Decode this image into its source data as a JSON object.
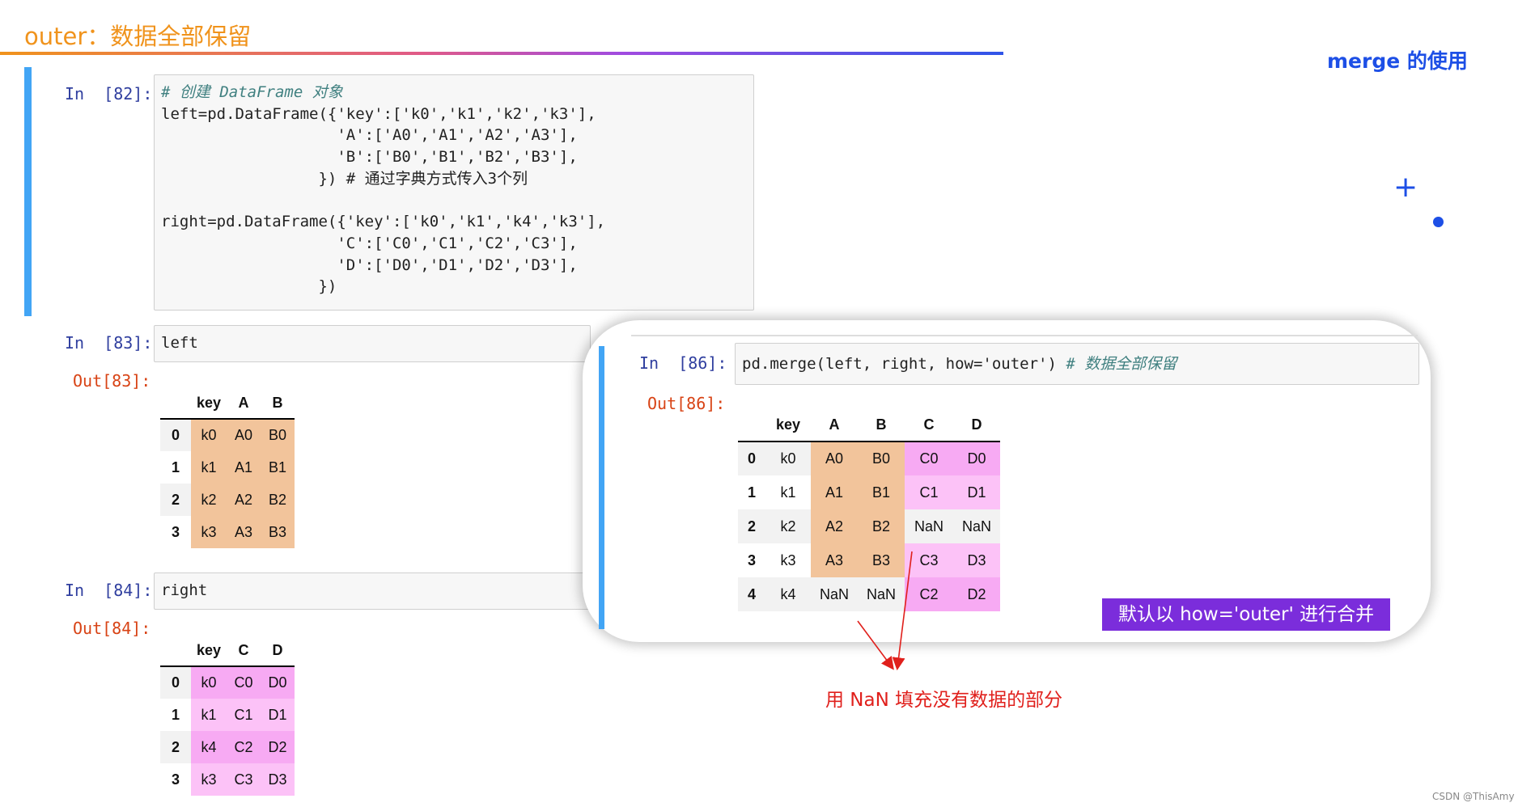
{
  "header": {
    "title": "outer：数据全部保留",
    "brand": "merge 的使用"
  },
  "icons": {
    "plus": "+",
    "accent_color": "#1d4fe6"
  },
  "cells": [
    {
      "in_prompt": "In  [82]:",
      "code_lines": [
        "# 创建 DataFrame 对象",
        "left=pd.DataFrame({'key':['k0','k1','k2','k3'],",
        "                   'A':['A0','A1','A2','A3'],",
        "                   'B':['B0','B1','B2','B3'],",
        "                 }) # 通过字典方式传入3个列",
        "",
        "right=pd.DataFrame({'key':['k0','k1','k4','k3'],",
        "                   'C':['C0','C1','C2','C3'],",
        "                   'D':['D0','D1','D2','D3'],",
        "                 })"
      ]
    },
    {
      "in_prompt": "In  [83]:",
      "code": "left",
      "out_prompt": "Out[83]:",
      "table": {
        "columns": [
          "key",
          "A",
          "B"
        ],
        "index": [
          "0",
          "1",
          "2",
          "3"
        ],
        "rows": [
          [
            "k0",
            "A0",
            "B0"
          ],
          [
            "k1",
            "A1",
            "B1"
          ],
          [
            "k2",
            "A2",
            "B2"
          ],
          [
            "k3",
            "A3",
            "B3"
          ]
        ]
      }
    },
    {
      "in_prompt": "In  [84]:",
      "code": "right",
      "out_prompt": "Out[84]:",
      "table": {
        "columns": [
          "key",
          "C",
          "D"
        ],
        "index": [
          "0",
          "1",
          "2",
          "3"
        ],
        "rows": [
          [
            "k0",
            "C0",
            "D0"
          ],
          [
            "k1",
            "C1",
            "D1"
          ],
          [
            "k4",
            "C2",
            "D2"
          ],
          [
            "k3",
            "C3",
            "D3"
          ]
        ]
      }
    },
    {
      "in_prompt": "In  [86]:",
      "code": "pd.merge(left, right, how='outer')",
      "comment": "# 数据全部保留",
      "out_prompt": "Out[86]:",
      "table": {
        "columns": [
          "key",
          "A",
          "B",
          "C",
          "D"
        ],
        "index": [
          "0",
          "1",
          "2",
          "3",
          "4"
        ],
        "rows": [
          [
            "k0",
            "A0",
            "B0",
            "C0",
            "D0"
          ],
          [
            "k1",
            "A1",
            "B1",
            "C1",
            "D1"
          ],
          [
            "k2",
            "A2",
            "B2",
            "NaN",
            "NaN"
          ],
          [
            "k3",
            "A3",
            "B3",
            "C3",
            "D3"
          ],
          [
            "k4",
            "NaN",
            "NaN",
            "C2",
            "D2"
          ]
        ]
      }
    }
  ],
  "badge": "默认以 how='outer' 进行合并",
  "annotation": "用 NaN 填充没有数据的部分",
  "watermark": "CSDN @ThisAmy",
  "colors": {
    "orange_cell": "#f2c49b",
    "pink_cell": "#f7aaf3",
    "pink_cell_light": "#fcc2f7",
    "prompt_in": "#303f9f",
    "prompt_out": "#d84315"
  }
}
